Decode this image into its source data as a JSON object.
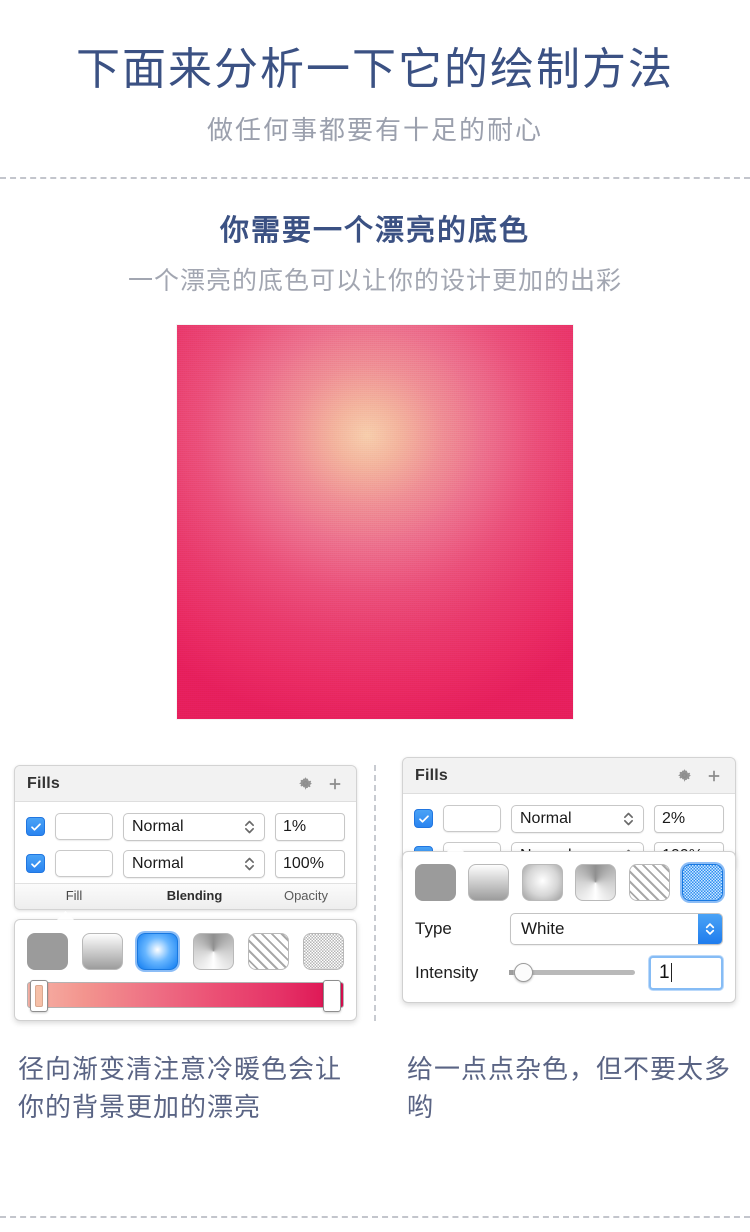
{
  "header": {
    "title": "下面来分析一下它的绘制方法",
    "subtitle": "做任何事都要有十足的耐心"
  },
  "section": {
    "heading": "你需要一个漂亮的底色",
    "subheading": "一个漂亮的底色可以让你的设计更加的出彩"
  },
  "preview": {
    "center_color": "#f7cdab",
    "edge_color": "#e61f5c"
  },
  "left_panel": {
    "title": "Fills",
    "gear_icon": "gear-icon",
    "plus_icon": "plus-icon",
    "rows": [
      {
        "checked": true,
        "swatch": "noise-pattern",
        "blending": "Normal",
        "opacity": "1%"
      },
      {
        "checked": true,
        "swatch": "red-radial-gradient",
        "blending": "Normal",
        "opacity": "100%"
      }
    ],
    "footer": {
      "fill": "Fill",
      "blending": "Blending",
      "opacity": "Opacity"
    },
    "fill_types": [
      {
        "name": "solid",
        "selected": false
      },
      {
        "name": "linear-gradient",
        "selected": false
      },
      {
        "name": "radial-gradient",
        "selected": true
      },
      {
        "name": "angular-gradient",
        "selected": false
      },
      {
        "name": "pattern",
        "selected": false
      },
      {
        "name": "noise",
        "selected": false
      }
    ],
    "gradient_bar": {
      "start_color": "#f6b2a6",
      "end_color": "#dc0d4f"
    }
  },
  "right_panel": {
    "title": "Fills",
    "gear_icon": "gear-icon",
    "plus_icon": "plus-icon",
    "rows": [
      {
        "checked": true,
        "swatch": "noise-pattern",
        "blending": "Normal",
        "opacity": "2%"
      },
      {
        "checked": true,
        "swatch": "red-radial-gradient",
        "blending": "Normal",
        "opacity": "100%"
      }
    ],
    "fill_types": [
      {
        "name": "solid",
        "selected": false
      },
      {
        "name": "linear-gradient",
        "selected": false
      },
      {
        "name": "radial-gradient",
        "selected": false
      },
      {
        "name": "angular-gradient",
        "selected": false
      },
      {
        "name": "pattern",
        "selected": false
      },
      {
        "name": "noise",
        "selected": true
      }
    ],
    "type_label": "Type",
    "type_value": "White",
    "intensity_label": "Intensity",
    "intensity_value": "1"
  },
  "captions": {
    "left": "径向渐变清注意冷暖色会让你的背景更加的漂亮",
    "right": "给一点点杂色，但不要太多哟"
  },
  "colors": {
    "title_blue": "#3b5183",
    "muted_gray": "#9ba0ad",
    "caption_blue": "#5a6484",
    "accent_blue": "#2d86ef"
  }
}
